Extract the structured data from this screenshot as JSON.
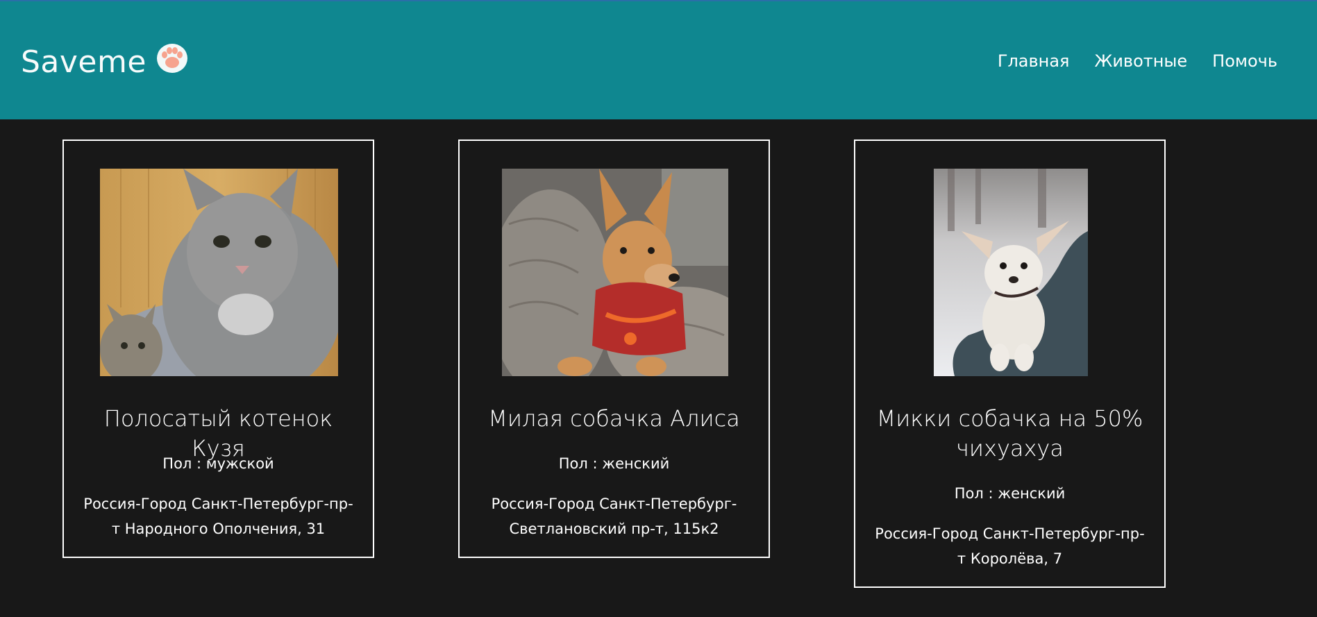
{
  "header": {
    "logo": "Saveme",
    "logo_icon": "paw-icon",
    "nav": [
      "Главная",
      "Животные",
      "Помочь"
    ]
  },
  "colors": {
    "header_bg": "#0f8790",
    "page_bg": "#181818",
    "text": "#ffffff"
  },
  "animals": [
    {
      "title": "Полосатый котенок Кузя",
      "sex": "Пол : мужской",
      "address": "Россия-Город Санкт-Петербург-пр-т Народного Ополчения, 31",
      "photo": "striped-kitten-photo"
    },
    {
      "title": "Милая собачка Алиса",
      "sex": "Пол : женский",
      "address": "Россия-Город Санкт-Петербург-Светлановский пр-т, 115к2",
      "photo": "ginger-dog-photo"
    },
    {
      "title": "Микки собачка на 50% чихуахуа",
      "sex": "Пол : женский",
      "address": "Россия-Город Санкт-Петербург-пр-т Королёва, 7",
      "photo": "white-chihuahua-photo"
    }
  ]
}
